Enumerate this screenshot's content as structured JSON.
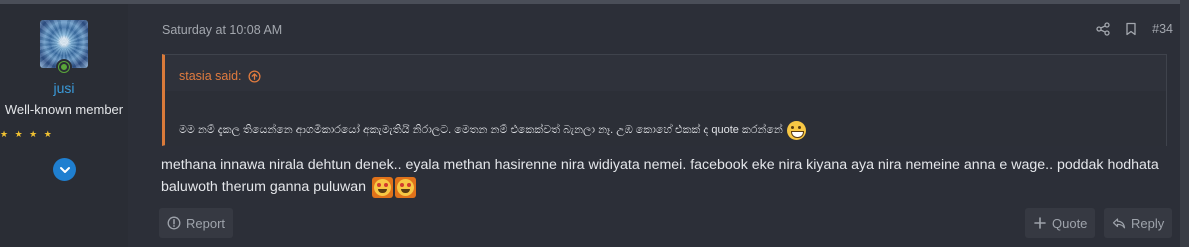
{
  "user": {
    "name": "jusi",
    "title": "Well-known member",
    "stars": "★ ★ ★ ★"
  },
  "post": {
    "timestamp": "Saturday at 10:08 AM",
    "number": "#34",
    "quote": {
      "author": "stasia said:",
      "text": "මම නම් දැකල තියෙන්නෙ ආගමිකාරයෝ අකැමැතියි නිරාලට. මෙතන නම් එකෙක්වත් බැනලා නෑ. උඹ කොහේ එකක් ද quote කරන්නේ"
    },
    "message": "methana innawa nirala dehtun denek.. eyala methan hasirenne nira widiyata nemei. facebook eke nira kiyana aya nira nemeine anna e wage.. poddak hodhata baluwoth therum ganna puluwan"
  },
  "actions": {
    "report": "Report",
    "quote": "Quote",
    "reply": "Reply"
  },
  "colors": {
    "background": "#2c2f38",
    "username": "#3a9ad9",
    "quote_accent": "#e07b3f",
    "online": "#5aa63a",
    "stars": "#f1c232"
  }
}
